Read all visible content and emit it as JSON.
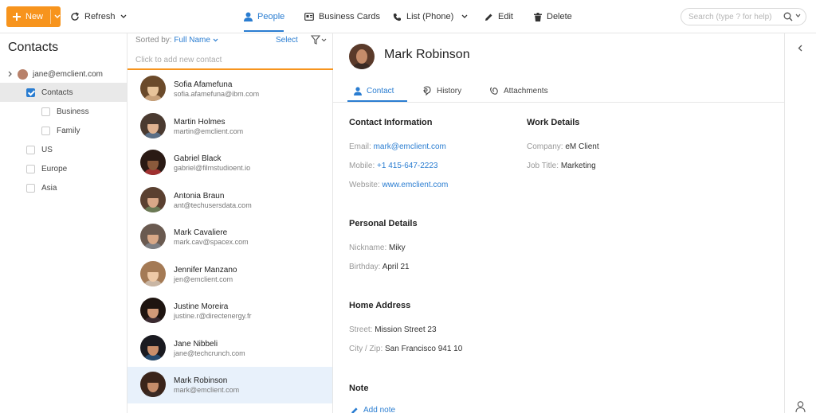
{
  "toolbar": {
    "new_label": "New",
    "refresh_label": "Refresh",
    "people_label": "People",
    "business_cards_label": "Business Cards",
    "list_phone_label": "List (Phone)",
    "edit_label": "Edit",
    "delete_label": "Delete",
    "search_placeholder": "Search (type ? for help)",
    "accent_color": "#f7941d"
  },
  "sidebar": {
    "title": "Contacts",
    "account": "jane@emclient.com",
    "folders": [
      {
        "label": "Contacts",
        "checked": true
      },
      {
        "label": "Business",
        "checked": false
      },
      {
        "label": "Family",
        "checked": false
      },
      {
        "label": "US",
        "checked": false
      },
      {
        "label": "Europe",
        "checked": false
      },
      {
        "label": "Asia",
        "checked": false
      }
    ]
  },
  "list": {
    "sorted_by_label": "Sorted by:",
    "sorted_by_value": "Full Name",
    "select_label": "Select",
    "add_new_placeholder": "Click to add new contact",
    "contacts": [
      {
        "name": "Sofia Afamefuna",
        "email": "sofia.afamefuna@ibm.com",
        "colors": [
          "#e8c49a",
          "#6b4a2a",
          "#c9a27a"
        ]
      },
      {
        "name": "Martin Holmes",
        "email": "martin@emclient.com",
        "colors": [
          "#e0b391",
          "#4a3a30",
          "#5b6f86"
        ]
      },
      {
        "name": "Gabriel Black",
        "email": "gabriel@filmstudioent.io",
        "colors": [
          "#8a5a3c",
          "#2a1a14",
          "#a03030"
        ]
      },
      {
        "name": "Antonia Braun",
        "email": "ant@techusersdata.com",
        "colors": [
          "#d9a888",
          "#5a4030",
          "#6b7a55"
        ]
      },
      {
        "name": "Mark Cavaliere",
        "email": "mark.cav@spacex.com",
        "colors": [
          "#d8a887",
          "#6a5a50",
          "#7d7f84"
        ]
      },
      {
        "name": "Jennifer Manzano",
        "email": "jen@emclient.com",
        "colors": [
          "#eec9a6",
          "#a47a55",
          "#c9b6a4"
        ]
      },
      {
        "name": "Justine Moreira",
        "email": "justine.r@directenergy.fr",
        "colors": [
          "#d29a78",
          "#1e1410",
          "#3a2a30"
        ]
      },
      {
        "name": "Jane Nibbeli",
        "email": "jane@techcrunch.com",
        "colors": [
          "#c98e6a",
          "#1a1a20",
          "#264a6e"
        ]
      },
      {
        "name": "Mark Robinson",
        "email": "mark@emclient.com",
        "colors": [
          "#c58c6a",
          "#3a241a",
          "#3a2a24"
        ]
      }
    ]
  },
  "detail": {
    "name": "Mark Robinson",
    "tabs": [
      "Contact",
      "History",
      "Attachments"
    ],
    "contact_info": {
      "title": "Contact Information",
      "email_label": "Email:",
      "email": "mark@emclient.com",
      "mobile_label": "Mobile:",
      "mobile": "+1 415-647-2223",
      "website_label": "Website:",
      "website": "www.emclient.com"
    },
    "work": {
      "title": "Work Details",
      "company_label": "Company:",
      "company": "eM Client",
      "job_label": "Job Title:",
      "job": "Marketing"
    },
    "personal": {
      "title": "Personal Details",
      "nickname_label": "Nickname:",
      "nickname": "Miky",
      "birthday_label": "Birthday:",
      "birthday": "April 21"
    },
    "home": {
      "title": "Home Address",
      "street_label": "Street:",
      "street": "Mission Street 23",
      "city_label": "City / Zip:",
      "city": "San Francisco 941 10"
    },
    "note": {
      "title": "Note",
      "add_note_label": "Add note"
    }
  }
}
